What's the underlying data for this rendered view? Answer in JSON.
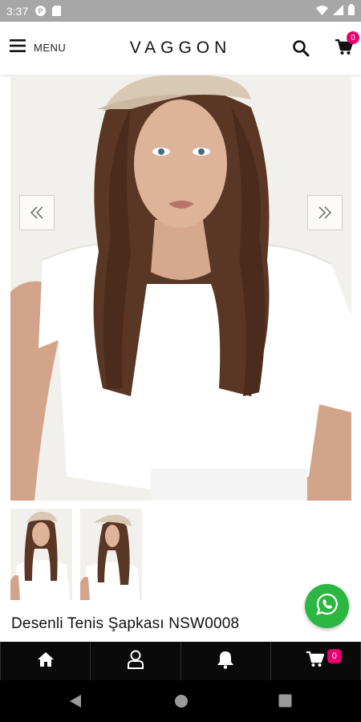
{
  "status_bar": {
    "time": "3:37"
  },
  "header": {
    "menu_label": "MENU",
    "logo": "VAGGON",
    "cart_count": "0"
  },
  "product": {
    "title": "Desenli Tenis Şapkası NSW0008",
    "image_icon": "product-photo",
    "prev_icon": "double-chevron-left-icon",
    "next_icon": "double-chevron-right-icon"
  },
  "bottom_nav": {
    "tabs": [
      {
        "icon": "home-icon"
      },
      {
        "icon": "user-icon"
      },
      {
        "icon": "bell-icon"
      },
      {
        "icon": "cart-icon",
        "badge": "0"
      }
    ]
  },
  "colors": {
    "accent_badge": "#e6006e",
    "whatsapp": "#2bb741",
    "bottom_bar": "#0a0a0a",
    "status_bar": "#a7a7a7"
  }
}
